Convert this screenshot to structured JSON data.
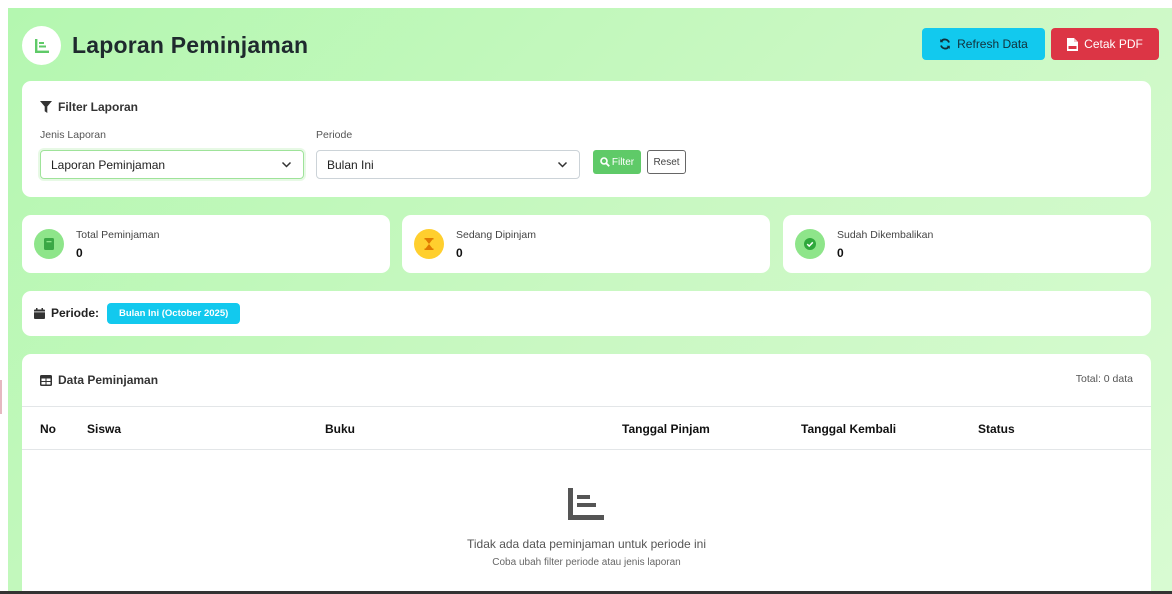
{
  "header": {
    "title": "Laporan Peminjaman",
    "refresh_label": "Refresh Data",
    "pdf_label": "Cetak PDF"
  },
  "filter": {
    "title": "Filter Laporan",
    "jenis_label": "Jenis Laporan",
    "jenis_value": "Laporan Peminjaman",
    "periode_label": "Periode",
    "periode_value": "Bulan Ini",
    "filter_button": "Filter",
    "reset_button": "Reset"
  },
  "stats": [
    {
      "label": "Total Peminjaman",
      "value": "0",
      "icon": "book-icon",
      "color": "#8ee58a"
    },
    {
      "label": "Sedang Dipinjam",
      "value": "0",
      "icon": "hourglass-icon",
      "color": "#ffcf2e"
    },
    {
      "label": "Sudah Dikembalikan",
      "value": "0",
      "icon": "check-circle-icon",
      "color": "#8ee58a"
    }
  ],
  "period": {
    "label": "Periode:",
    "badge": "Bulan Ini (October 2025)"
  },
  "table": {
    "title": "Data Peminjaman",
    "total": "Total: 0 data",
    "columns": [
      "No",
      "Siswa",
      "Buku",
      "Tanggal Pinjam",
      "Tanggal Kembali",
      "Status"
    ],
    "empty_message": "Tidak ada data peminjaman untuk periode ini",
    "empty_hint": "Coba ubah filter periode atau jenis laporan"
  },
  "colors": {
    "accent_green": "#5fca68",
    "info": "#12c9ee",
    "danger": "#dc3545"
  }
}
